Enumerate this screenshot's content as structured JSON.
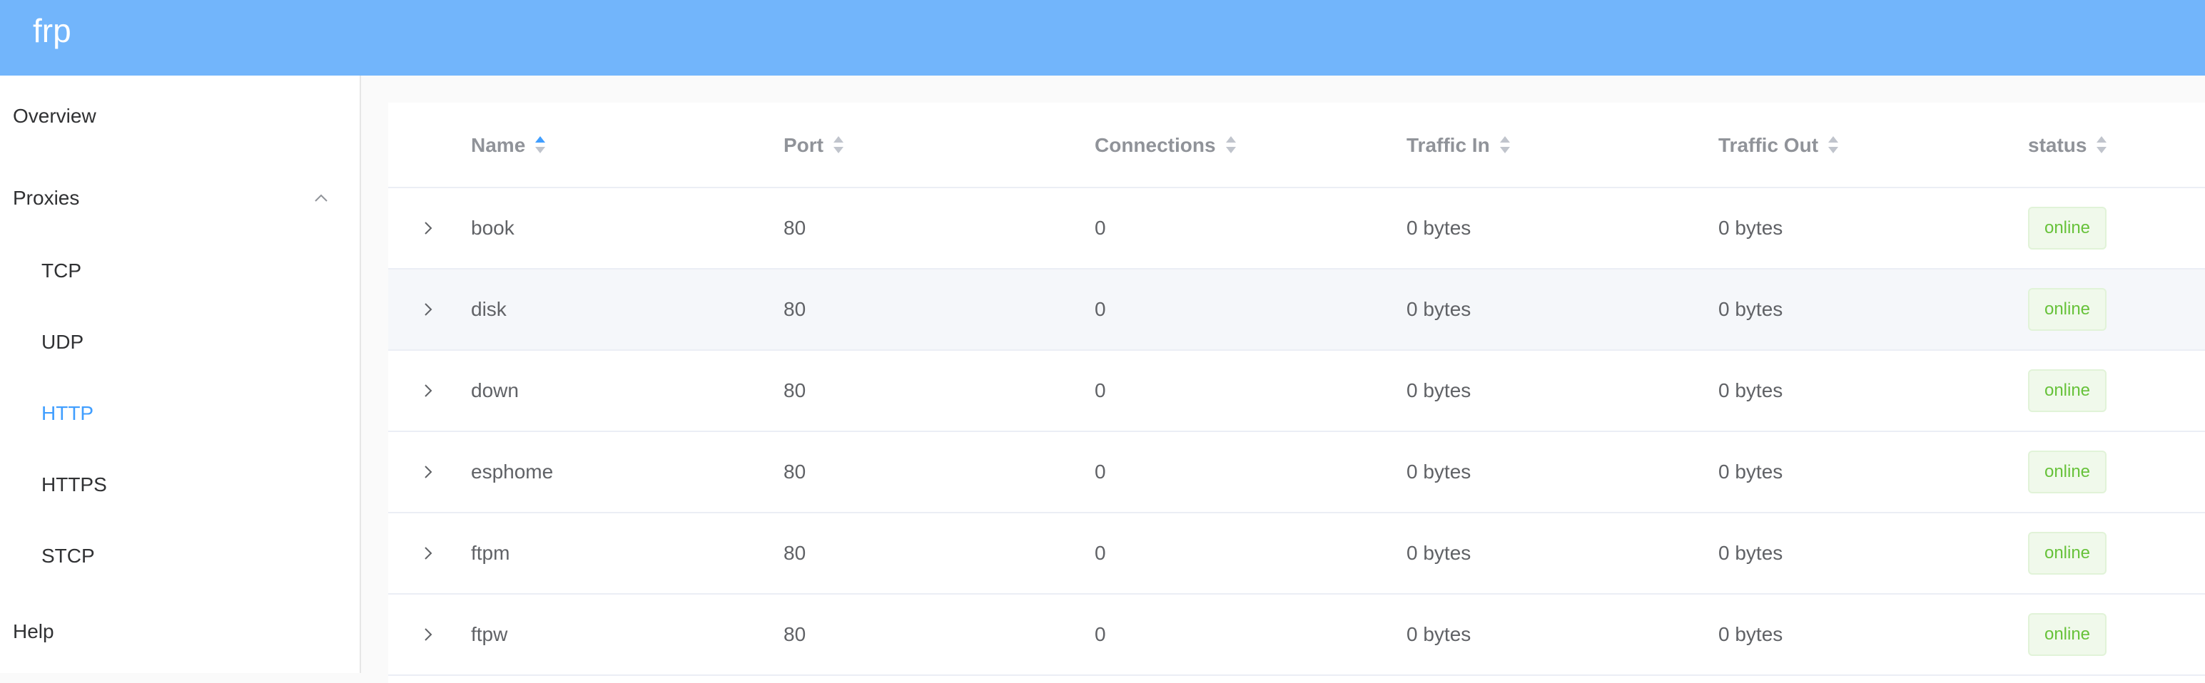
{
  "app": {
    "title": "frp"
  },
  "sidebar": {
    "overview": "Overview",
    "proxies": "Proxies",
    "sub_items": [
      "TCP",
      "UDP",
      "HTTP",
      "HTTPS",
      "STCP"
    ],
    "active_item": "HTTP",
    "help": "Help"
  },
  "table": {
    "columns": [
      "Name",
      "Port",
      "Connections",
      "Traffic In",
      "Traffic Out",
      "status"
    ],
    "sorted_column": "Name",
    "sort_direction": "ascending",
    "rows": [
      {
        "name": "book",
        "port": "80",
        "connections": "0",
        "traffic_in": "0 bytes",
        "traffic_out": "0 bytes",
        "status": "online"
      },
      {
        "name": "disk",
        "port": "80",
        "connections": "0",
        "traffic_in": "0 bytes",
        "traffic_out": "0 bytes",
        "status": "online"
      },
      {
        "name": "down",
        "port": "80",
        "connections": "0",
        "traffic_in": "0 bytes",
        "traffic_out": "0 bytes",
        "status": "online"
      },
      {
        "name": "esphome",
        "port": "80",
        "connections": "0",
        "traffic_in": "0 bytes",
        "traffic_out": "0 bytes",
        "status": "online"
      },
      {
        "name": "ftpm",
        "port": "80",
        "connections": "0",
        "traffic_in": "0 bytes",
        "traffic_out": "0 bytes",
        "status": "online"
      },
      {
        "name": "ftpw",
        "port": "80",
        "connections": "0",
        "traffic_in": "0 bytes",
        "traffic_out": "0 bytes",
        "status": "online"
      }
    ]
  },
  "colors": {
    "header_bg": "#72b5fb",
    "accent": "#409eff",
    "status_online": "#67c23a"
  },
  "icons": {
    "sort": "caret-up-down-icon",
    "expand": "chevron-right-icon",
    "submenu": "chevron-up-icon"
  }
}
